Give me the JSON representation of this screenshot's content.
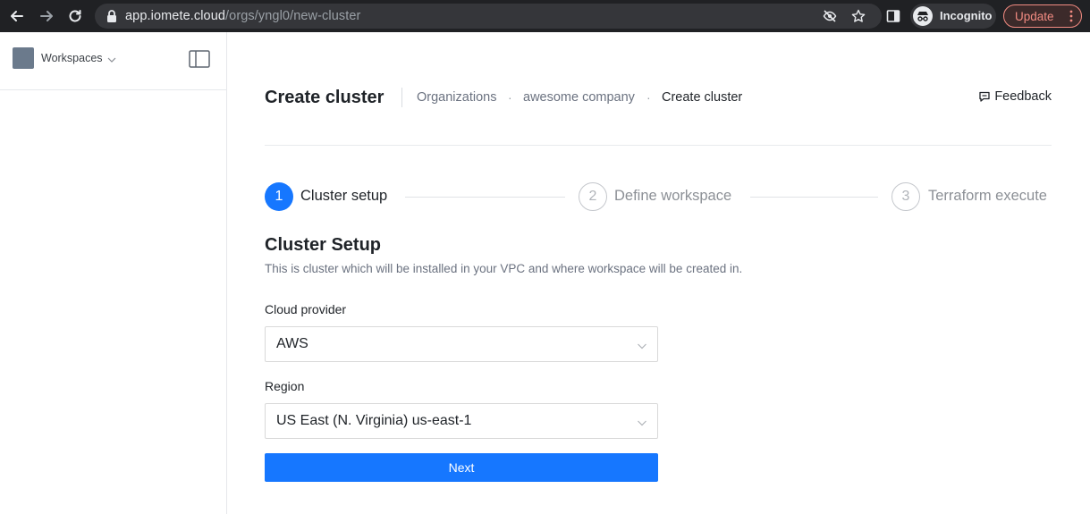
{
  "browser": {
    "url_host": "app.iomete.cloud",
    "url_path": "/orgs/yngl0/new-cluster",
    "incognito_label": "Incognito",
    "update_label": "Update",
    "icons": [
      "back-arrow-icon",
      "forward-arrow-icon",
      "reload-icon",
      "lock-icon",
      "eye-off-icon",
      "star-icon",
      "sidebar-panel-icon",
      "incognito-icon",
      "kebab-menu-icon"
    ]
  },
  "sidebar": {
    "workspace_label": "Workspaces"
  },
  "header": {
    "title": "Create cluster",
    "breadcrumb": [
      "Organizations",
      "awesome company",
      "Create cluster"
    ],
    "feedback_label": "Feedback"
  },
  "steps": [
    {
      "number": "1",
      "label": "Cluster setup",
      "state": "active"
    },
    {
      "number": "2",
      "label": "Define workspace",
      "state": "pending"
    },
    {
      "number": "3",
      "label": "Terraform execute",
      "state": "pending"
    }
  ],
  "form": {
    "section_title": "Cluster Setup",
    "section_desc": "This is cluster which will be installed in your VPC and where workspace will be created in.",
    "cloud_provider_label": "Cloud provider",
    "cloud_provider_value": "AWS",
    "region_label": "Region",
    "region_value": "US East (N. Virginia) us-east-1",
    "next_label": "Next"
  },
  "colors": {
    "primary": "#1677ff",
    "update_accent": "#f28b82"
  }
}
